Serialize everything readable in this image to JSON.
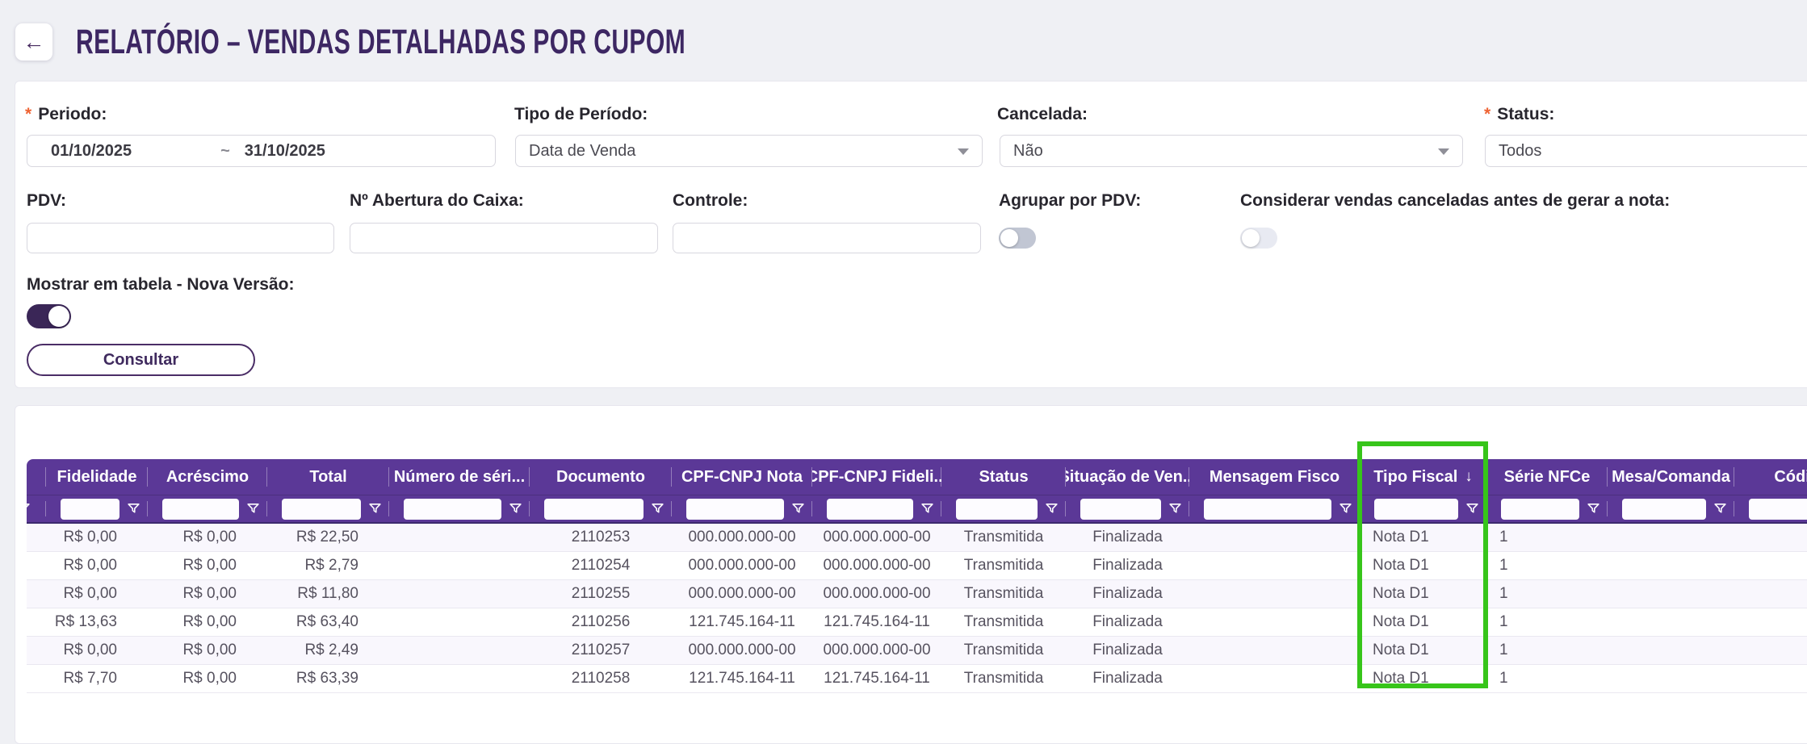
{
  "header": {
    "back_icon": "←",
    "title": "RELATÓRIO – VENDAS DETALHADAS POR CUPOM"
  },
  "filters": {
    "required_marker": "*",
    "periodo": {
      "label": "Periodo:",
      "required": true,
      "start": "01/10/2025",
      "separator": "~",
      "end": "31/10/2025"
    },
    "tipo_periodo": {
      "label": "Tipo de Período:",
      "value": "Data de Venda"
    },
    "cancelada": {
      "label": "Cancelada:",
      "value": "Não"
    },
    "status": {
      "label": "Status:",
      "required": true,
      "value": "Todos"
    },
    "pdv": {
      "label": "PDV:",
      "value": ""
    },
    "abertura_caixa": {
      "label": "Nº Abertura do Caixa:",
      "value": ""
    },
    "controle": {
      "label": "Controle:",
      "value": ""
    },
    "agrupar_pdv": {
      "label": "Agrupar por PDV:",
      "state": "off"
    },
    "considerar_vendas": {
      "label": "Considerar vendas canceladas antes de gerar a nota:",
      "state": "off"
    },
    "mostrar_tabela": {
      "label": "Mostrar em tabela - Nova Versão:",
      "state": "on"
    },
    "consultar_label": "Consultar"
  },
  "table": {
    "columns": [
      "",
      "Fidelidade",
      "Acréscimo",
      "Total",
      "Número de séri...",
      "Documento",
      "CPF-CNPJ Nota",
      "CPF-CNPJ Fideli...",
      "Status",
      "Situação de Ven...",
      "Mensagem Fisco",
      "Tipo Fiscal",
      "Série NFCe",
      "Mesa/Comanda",
      "Códig..."
    ],
    "sort": {
      "column": "Tipo Fiscal",
      "icon": "↓",
      "direction": "desc"
    },
    "rows": [
      [
        "",
        "R$ 0,00",
        "R$ 0,00",
        "R$ 22,50",
        "",
        "2110253",
        "000.000.000-00",
        "000.000.000-00",
        "Transmitida",
        "Finalizada",
        "",
        "Nota D1",
        "1",
        "",
        ""
      ],
      [
        "",
        "R$ 0,00",
        "R$ 0,00",
        "R$ 2,79",
        "",
        "2110254",
        "000.000.000-00",
        "000.000.000-00",
        "Transmitida",
        "Finalizada",
        "",
        "Nota D1",
        "1",
        "",
        ""
      ],
      [
        "",
        "R$ 0,00",
        "R$ 0,00",
        "R$ 11,80",
        "",
        "2110255",
        "000.000.000-00",
        "000.000.000-00",
        "Transmitida",
        "Finalizada",
        "",
        "Nota D1",
        "1",
        "",
        ""
      ],
      [
        "",
        "R$ 13,63",
        "R$ 0,00",
        "R$ 63,40",
        "",
        "2110256",
        "121.745.164-11",
        "121.745.164-11",
        "Transmitida",
        "Finalizada",
        "",
        "Nota D1",
        "1",
        "",
        ""
      ],
      [
        "",
        "R$ 0,00",
        "R$ 0,00",
        "R$ 2,49",
        "",
        "2110257",
        "000.000.000-00",
        "000.000.000-00",
        "Transmitida",
        "Finalizada",
        "",
        "Nota D1",
        "1",
        "",
        ""
      ],
      [
        "",
        "R$ 7,70",
        "R$ 0,00",
        "R$ 63,39",
        "",
        "2110258",
        "121.745.164-11",
        "121.745.164-11",
        "Transmitida",
        "Finalizada",
        "",
        "Nota D1",
        "1",
        "",
        ""
      ]
    ]
  },
  "annotation": {
    "color": "#37c51a"
  },
  "colors": {
    "header_purple": "#5b3897",
    "brand_purple": "#3f2a5e",
    "highlight_green": "#37c51a",
    "asterisk_orange": "#ee6333",
    "toggle_on_purple": "#3a2657",
    "page_background": "#eff0f4"
  }
}
